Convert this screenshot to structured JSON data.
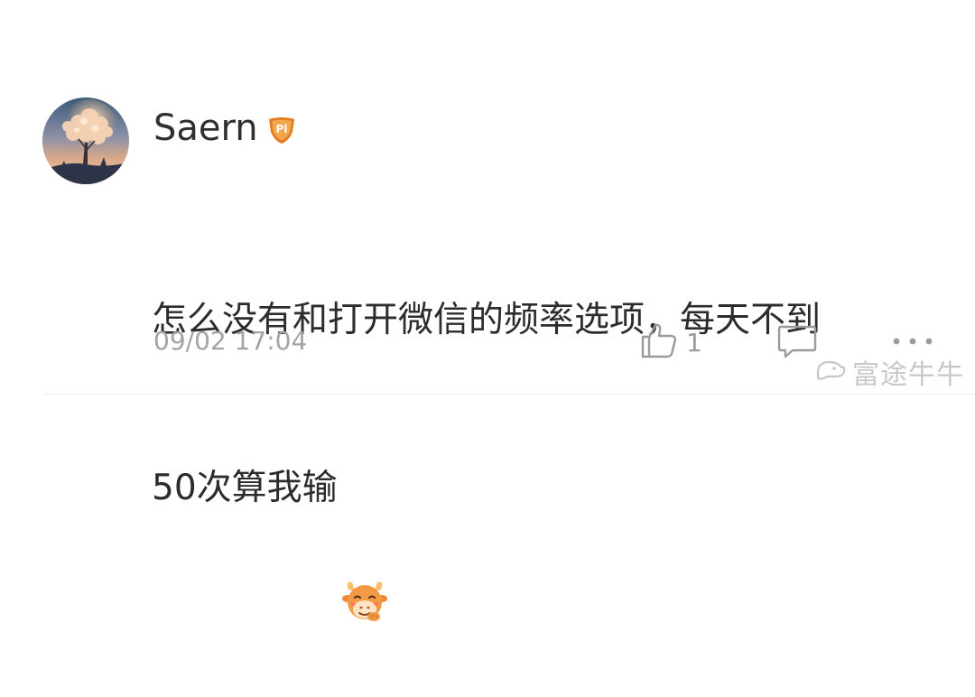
{
  "comment": {
    "author": {
      "name": "Saern",
      "badge_text": "Pl",
      "badge_color": "#e37a1f",
      "avatar_icon": "tree-sunset-avatar"
    },
    "content": {
      "line1": "怎么没有和打开微信的频率选项，每天不到",
      "line2": "50次算我输",
      "emoji_icon": "bull-face-emoji"
    },
    "timestamp": "09/02 17:04",
    "actions": {
      "like_icon": "thumbs-up-icon",
      "like_count": "1",
      "reply_icon": "comment-bubble-icon",
      "more_icon": "more-dots-icon"
    }
  },
  "watermark": {
    "text": "富途牛牛",
    "icon": "futu-logo-icon"
  },
  "colors": {
    "text_primary": "#2c2c2c",
    "text_secondary": "#a3a3a3",
    "badge": "#e37a1f",
    "divider": "#ececec"
  }
}
